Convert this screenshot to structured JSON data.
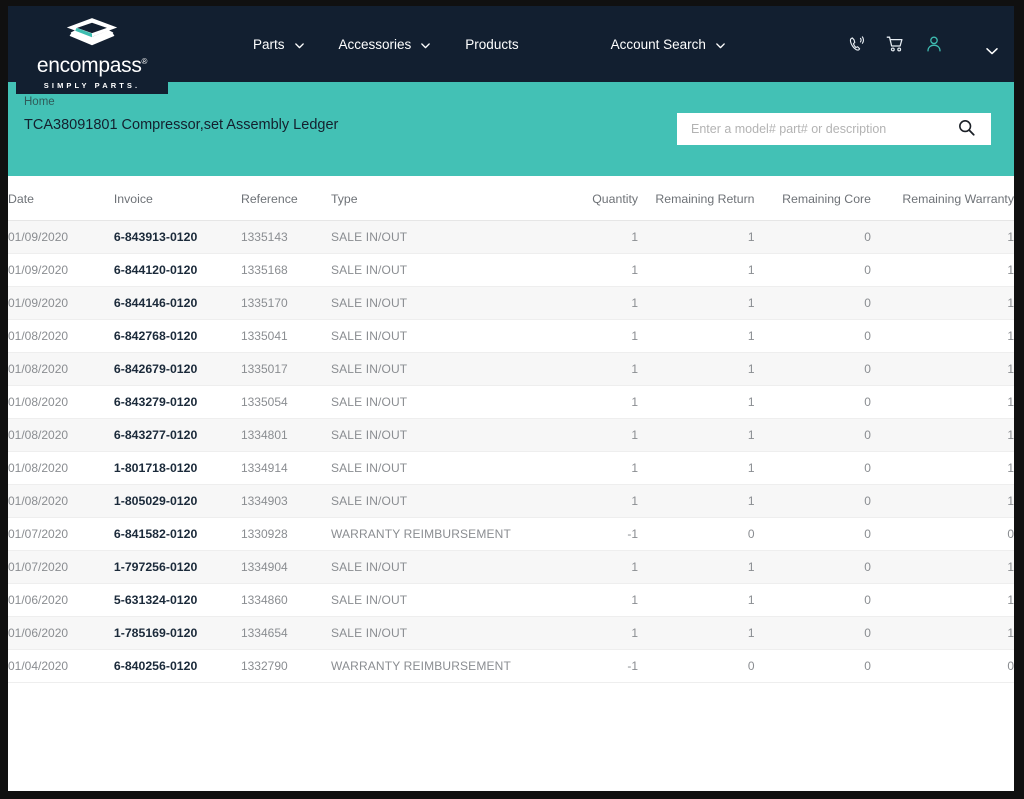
{
  "brand": {
    "logo_word": "encompass",
    "logo_registered": "®",
    "logo_tagline": "SIMPLY PARTS.",
    "navy": "#121f30",
    "teal": "#43c1b5"
  },
  "nav": {
    "items": [
      {
        "label": "Parts",
        "has_caret": true
      },
      {
        "label": "Accessories",
        "has_caret": true
      },
      {
        "label": "Products",
        "has_caret": false
      },
      {
        "label": "Account Search",
        "has_caret": true
      }
    ],
    "icons": [
      {
        "name": "phone-icon"
      },
      {
        "name": "cart-icon"
      },
      {
        "name": "user-icon"
      },
      {
        "name": "chevron-down-icon"
      }
    ]
  },
  "header": {
    "breadcrumb": "Home",
    "title": "TCA38091801 Compressor,set Assembly Ledger"
  },
  "search": {
    "placeholder": "Enter a model# part# or description",
    "value": "",
    "icon": "search-icon"
  },
  "table": {
    "columns": [
      {
        "key": "date",
        "label": "Date",
        "align": "left"
      },
      {
        "key": "invoice",
        "label": "Invoice",
        "align": "left"
      },
      {
        "key": "reference",
        "label": "Reference",
        "align": "left"
      },
      {
        "key": "type",
        "label": "Type",
        "align": "left"
      },
      {
        "key": "quantity",
        "label": "Quantity",
        "align": "right"
      },
      {
        "key": "rem_return",
        "label": "Remaining Return",
        "align": "right"
      },
      {
        "key": "rem_core",
        "label": "Remaining Core",
        "align": "right"
      },
      {
        "key": "rem_warranty",
        "label": "Remaining Warranty",
        "align": "right"
      }
    ],
    "rows": [
      {
        "date": "01/09/2020",
        "invoice": "6-843913-0120",
        "reference": "1335143",
        "type": "SALE IN/OUT",
        "quantity": "1",
        "rem_return": "1",
        "rem_core": "0",
        "rem_warranty": "1"
      },
      {
        "date": "01/09/2020",
        "invoice": "6-844120-0120",
        "reference": "1335168",
        "type": "SALE IN/OUT",
        "quantity": "1",
        "rem_return": "1",
        "rem_core": "0",
        "rem_warranty": "1"
      },
      {
        "date": "01/09/2020",
        "invoice": "6-844146-0120",
        "reference": "1335170",
        "type": "SALE IN/OUT",
        "quantity": "1",
        "rem_return": "1",
        "rem_core": "0",
        "rem_warranty": "1"
      },
      {
        "date": "01/08/2020",
        "invoice": "6-842768-0120",
        "reference": "1335041",
        "type": "SALE IN/OUT",
        "quantity": "1",
        "rem_return": "1",
        "rem_core": "0",
        "rem_warranty": "1"
      },
      {
        "date": "01/08/2020",
        "invoice": "6-842679-0120",
        "reference": "1335017",
        "type": "SALE IN/OUT",
        "quantity": "1",
        "rem_return": "1",
        "rem_core": "0",
        "rem_warranty": "1"
      },
      {
        "date": "01/08/2020",
        "invoice": "6-843279-0120",
        "reference": "1335054",
        "type": "SALE IN/OUT",
        "quantity": "1",
        "rem_return": "1",
        "rem_core": "0",
        "rem_warranty": "1"
      },
      {
        "date": "01/08/2020",
        "invoice": "6-843277-0120",
        "reference": "1334801",
        "type": "SALE IN/OUT",
        "quantity": "1",
        "rem_return": "1",
        "rem_core": "0",
        "rem_warranty": "1"
      },
      {
        "date": "01/08/2020",
        "invoice": "1-801718-0120",
        "reference": "1334914",
        "type": "SALE IN/OUT",
        "quantity": "1",
        "rem_return": "1",
        "rem_core": "0",
        "rem_warranty": "1"
      },
      {
        "date": "01/08/2020",
        "invoice": "1-805029-0120",
        "reference": "1334903",
        "type": "SALE IN/OUT",
        "quantity": "1",
        "rem_return": "1",
        "rem_core": "0",
        "rem_warranty": "1"
      },
      {
        "date": "01/07/2020",
        "invoice": "6-841582-0120",
        "reference": "1330928",
        "type": "WARRANTY REIMBURSEMENT",
        "quantity": "-1",
        "rem_return": "0",
        "rem_core": "0",
        "rem_warranty": "0"
      },
      {
        "date": "01/07/2020",
        "invoice": "1-797256-0120",
        "reference": "1334904",
        "type": "SALE IN/OUT",
        "quantity": "1",
        "rem_return": "1",
        "rem_core": "0",
        "rem_warranty": "1"
      },
      {
        "date": "01/06/2020",
        "invoice": "5-631324-0120",
        "reference": "1334860",
        "type": "SALE IN/OUT",
        "quantity": "1",
        "rem_return": "1",
        "rem_core": "0",
        "rem_warranty": "1"
      },
      {
        "date": "01/06/2020",
        "invoice": "1-785169-0120",
        "reference": "1334654",
        "type": "SALE IN/OUT",
        "quantity": "1",
        "rem_return": "1",
        "rem_core": "0",
        "rem_warranty": "1"
      },
      {
        "date": "01/04/2020",
        "invoice": "6-840256-0120",
        "reference": "1332790",
        "type": "WARRANTY REIMBURSEMENT",
        "quantity": "-1",
        "rem_return": "0",
        "rem_core": "0",
        "rem_warranty": "0"
      }
    ]
  }
}
